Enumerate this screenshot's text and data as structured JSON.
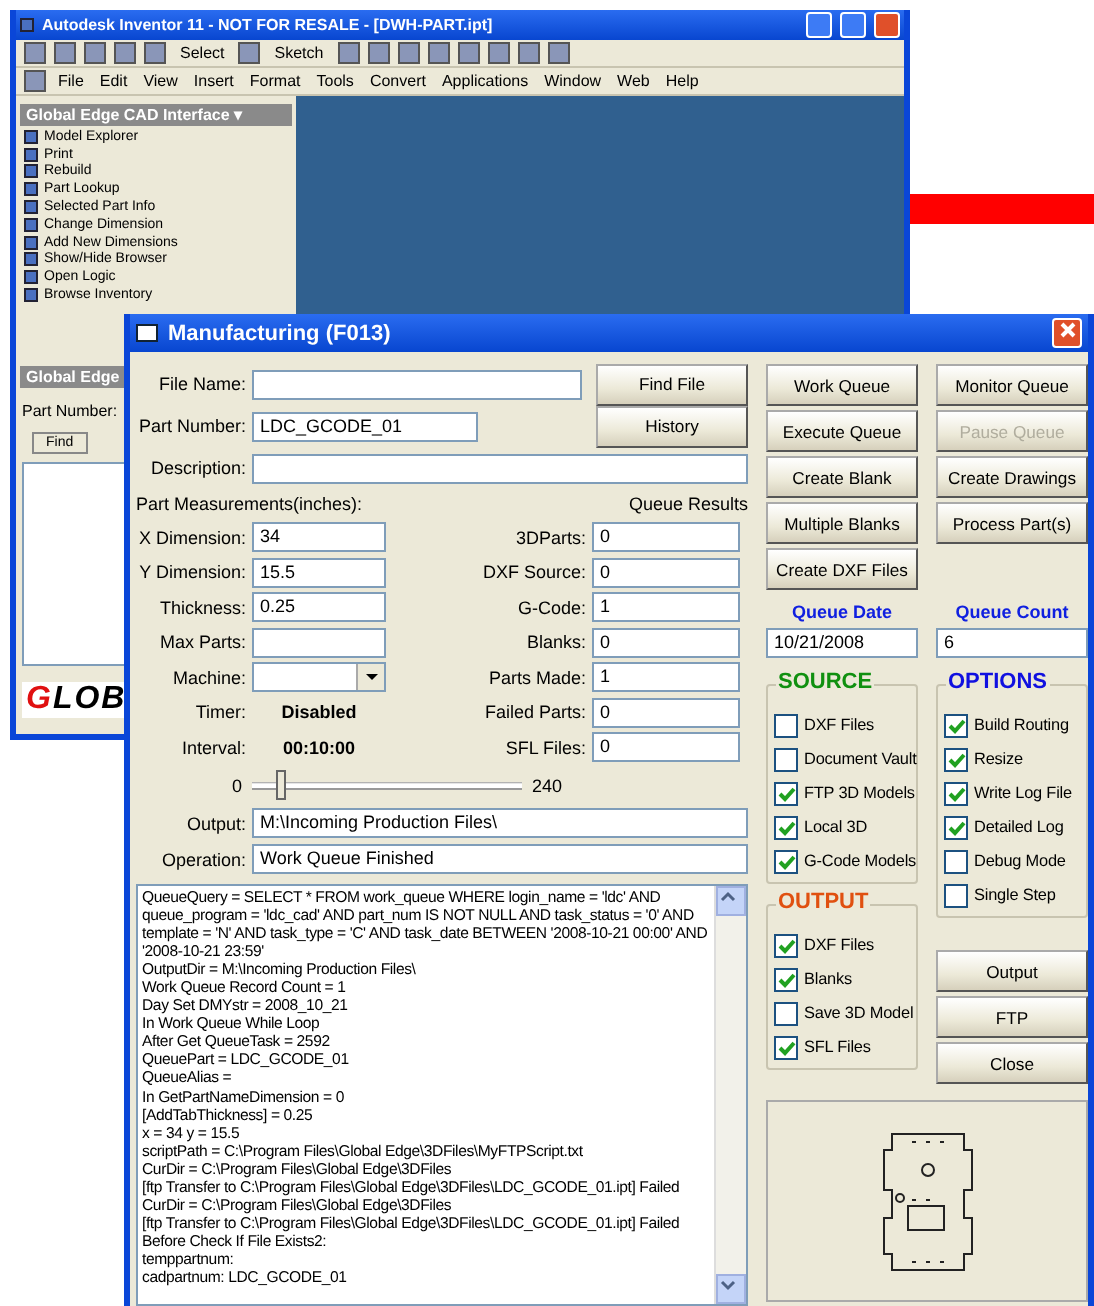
{
  "background_window": {
    "title": "Autodesk Inventor 11 - NOT FOR RESALE - [DWH-PART.ipt]",
    "toolbar": [
      "Select",
      "Sketch"
    ],
    "menu": [
      "File",
      "Edit",
      "View",
      "Insert",
      "Format",
      "Tools",
      "Convert",
      "Applications",
      "Window",
      "Web",
      "Help"
    ],
    "panel_title": "Global Edge CAD Interface ▾",
    "panel_items": [
      "Model Explorer",
      "Print",
      "Rebuild",
      "Part Lookup",
      "Selected Part Info",
      "Change Dimension",
      "Add New Dimensions",
      "Show/Hide Browser",
      "Open Logic",
      "Browse Inventory"
    ],
    "lower_panel_title": "Global Edge",
    "part_number_label": "Part Number:",
    "find_button": "Find",
    "logo": "GLOB"
  },
  "dialog": {
    "title": "Manufacturing  (F013)",
    "file_name": {
      "label": "File Name:"
    },
    "find_file_button": "Find File",
    "part_number": {
      "label": "Part Number:",
      "value": "LDC_GCODE_01"
    },
    "history_button": "History",
    "description": {
      "label": "Description:"
    },
    "measurements_heading": "Part Measurements(inches):",
    "queue_results_heading": "Queue Results",
    "measurements": [
      {
        "kind": "field",
        "label": "X Dimension:",
        "value": "34"
      },
      {
        "kind": "field",
        "label": "Y Dimension:",
        "value": "15.5"
      },
      {
        "kind": "field",
        "label": "Thickness:",
        "value": "0.25"
      },
      {
        "kind": "field",
        "label": "Max Parts:"
      },
      {
        "kind": "dropdown",
        "label": "Machine:"
      },
      {
        "kind": "status",
        "label": "Timer:",
        "value": "Disabled"
      },
      {
        "kind": "status",
        "label": "Interval:",
        "value": "00:10:00"
      }
    ],
    "queue_results": [
      {
        "label": "3DParts:",
        "value": "0"
      },
      {
        "label": "DXF Source:",
        "value": "0"
      },
      {
        "label": "G-Code:",
        "value": "1"
      },
      {
        "label": "Blanks:",
        "value": "0"
      },
      {
        "label": "Parts Made:",
        "value": "1"
      },
      {
        "label": "Failed Parts:",
        "value": "0"
      },
      {
        "label": "SFL Files:",
        "value": "0"
      }
    ],
    "slider": {
      "min_label": "0",
      "max_label": "240",
      "level": 0.1
    },
    "output": {
      "label": "Output:",
      "value": "M:\\Incoming Production Files\\"
    },
    "operation": {
      "label": "Operation:",
      "value": "Work Queue Finished"
    },
    "log": [
      "QueueQuery = SELECT * FROM work_queue WHERE login_name = 'ldc' AND queue_program = 'ldc_cad' AND part_num IS NOT NULL AND task_status = '0' AND template = 'N' AND task_type = 'C' AND task_date BETWEEN '2008-10-21 00:00' AND '2008-10-21 23:59'",
      "OutputDir = M:\\Incoming Production Files\\",
      "Work Queue Record Count = 1",
      "Day Set DMYstr = 2008_10_21",
      "In Work Queue While Loop",
      "After Get QueueTask = 2592",
      "QueuePart = LDC_GCODE_01",
      "QueueAlias =",
      "In GetPartNameDimension = 0",
      "[AddTabThickness] = 0.25",
      "x = 34 y = 15.5",
      "scriptPath = C:\\Program Files\\Global Edge\\3DFiles\\MyFTPScript.txt",
      "CurDir = C:\\Program Files\\Global Edge\\3DFiles",
      "[ftp Transfer to C:\\Program Files\\Global Edge\\3DFiles\\LDC_GCODE_01.ipt] Failed",
      "CurDir = C:\\Program Files\\Global Edge\\3DFiles",
      "[ftp Transfer to C:\\Program Files\\Global Edge\\3DFiles\\LDC_GCODE_01.ipt] Failed",
      "Before Check If File Exists2:",
      "temppartnum:",
      "cadpartnum: LDC_GCODE_01"
    ],
    "queue_buttons": [
      {
        "label": "Work Queue",
        "disabled": false
      },
      {
        "label": "Monitor Queue",
        "disabled": false
      },
      {
        "label": "Execute Queue",
        "disabled": false
      },
      {
        "label": "Pause Queue",
        "disabled": true
      },
      {
        "label": "Create Blank",
        "disabled": false
      },
      {
        "label": "Create Drawings",
        "disabled": false
      },
      {
        "label": "Multiple Blanks",
        "disabled": false
      },
      {
        "label": "Process Part(s)",
        "disabled": false
      },
      {
        "label": "Create DXF Files",
        "disabled": false
      }
    ],
    "queue_date": {
      "label": "Queue Date",
      "value": "10/21/2008"
    },
    "queue_count": {
      "label": "Queue Count",
      "value": "6"
    },
    "groups": [
      {
        "title": "SOURCE",
        "color": "#109010",
        "items": [
          {
            "label": "DXF Files",
            "checked": false
          },
          {
            "label": "Document Vault",
            "checked": false
          },
          {
            "label": "FTP 3D Models",
            "checked": true
          },
          {
            "label": "Local 3D",
            "checked": true
          },
          {
            "label": "G-Code Models",
            "checked": true
          }
        ]
      },
      {
        "title": "OPTIONS",
        "color": "#1010e0",
        "items": [
          {
            "label": "Build Routing",
            "checked": true
          },
          {
            "label": "Resize",
            "checked": true
          },
          {
            "label": "Write Log File",
            "checked": true
          },
          {
            "label": "Detailed Log",
            "checked": true
          },
          {
            "label": "Debug Mode",
            "checked": false
          },
          {
            "label": "Single Step",
            "checked": false
          }
        ]
      },
      {
        "title": "OUTPUT",
        "color": "#e05010",
        "items": [
          {
            "label": "DXF Files",
            "checked": true
          },
          {
            "label": "Blanks",
            "checked": true
          },
          {
            "label": "Save 3D Model",
            "checked": false
          },
          {
            "label": "SFL Files",
            "checked": true
          }
        ]
      }
    ],
    "action_buttons": [
      "Output",
      "FTP",
      "Close"
    ]
  }
}
